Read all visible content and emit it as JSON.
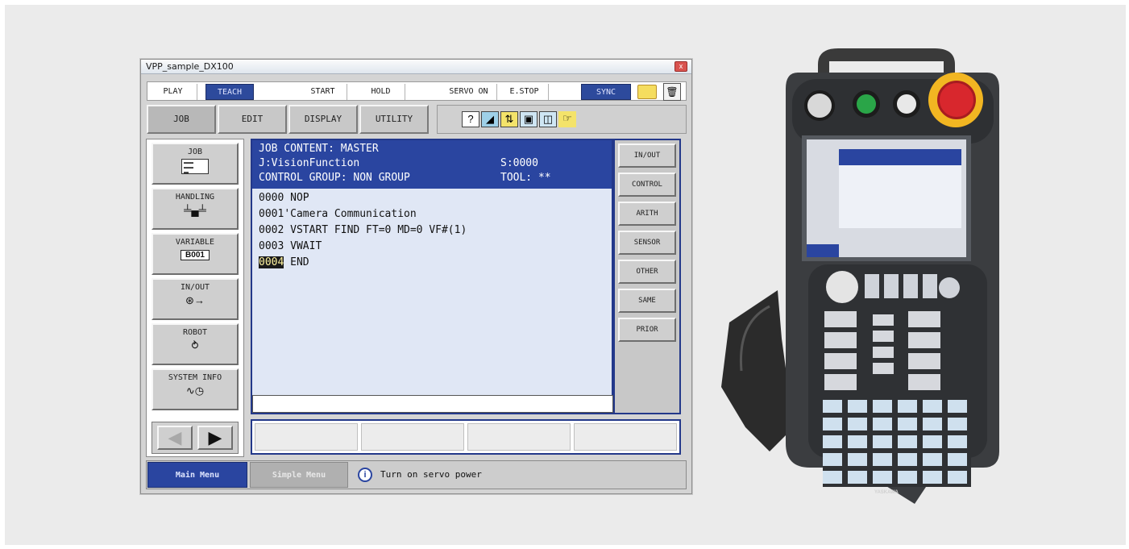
{
  "window": {
    "title": "VPP_sample_DX100",
    "close_label": "x"
  },
  "toolbar": {
    "play": "PLAY",
    "teach": "TEACH",
    "start": "START",
    "hold": "HOLD",
    "servo_on": "SERVO ON",
    "estop": "E.STOP",
    "sync": "SYNC",
    "trash_icon": "trash-icon",
    "folder_icon": "folder-icon"
  },
  "menu_tabs": [
    "JOB",
    "EDIT",
    "DISPLAY",
    "UTILITY"
  ],
  "left_menu": {
    "job": "JOB",
    "handling": "HANDLING",
    "variable": "VARIABLE",
    "variable_value": "B001",
    "inout": "IN/OUT",
    "robot": "ROBOT",
    "system_info": "SYSTEM INFO"
  },
  "content": {
    "header": [
      "JOB CONTENT: MASTER",
      "J:VisionFunction",
      "CONTROL GROUP: NON GROUP"
    ],
    "step": "S:0000",
    "tool": "TOOL: **",
    "lines": [
      {
        "no": "0000",
        "text": " NOP"
      },
      {
        "no": "0001",
        "text": "'Camera Communication"
      },
      {
        "no": "0002",
        "text": " VSTART FIND FT=0 MD=0 VF#(1)"
      },
      {
        "no": "0003",
        "text": " VWAIT"
      },
      {
        "no": "0004",
        "text": " END"
      }
    ]
  },
  "right_menu": [
    "IN/OUT",
    "CONTROL",
    "ARITH",
    "SENSOR",
    "OTHER",
    "SAME",
    "PRIOR"
  ],
  "status_bar": {
    "main_menu": "Main Menu",
    "simple_menu": "Simple Menu",
    "message": "Turn on servo power"
  },
  "device": {
    "brand": "YASKAWA"
  },
  "colors": {
    "header_blue": "#2a45a0",
    "estop_red": "#d8272d",
    "green_button": "#2aa548"
  }
}
